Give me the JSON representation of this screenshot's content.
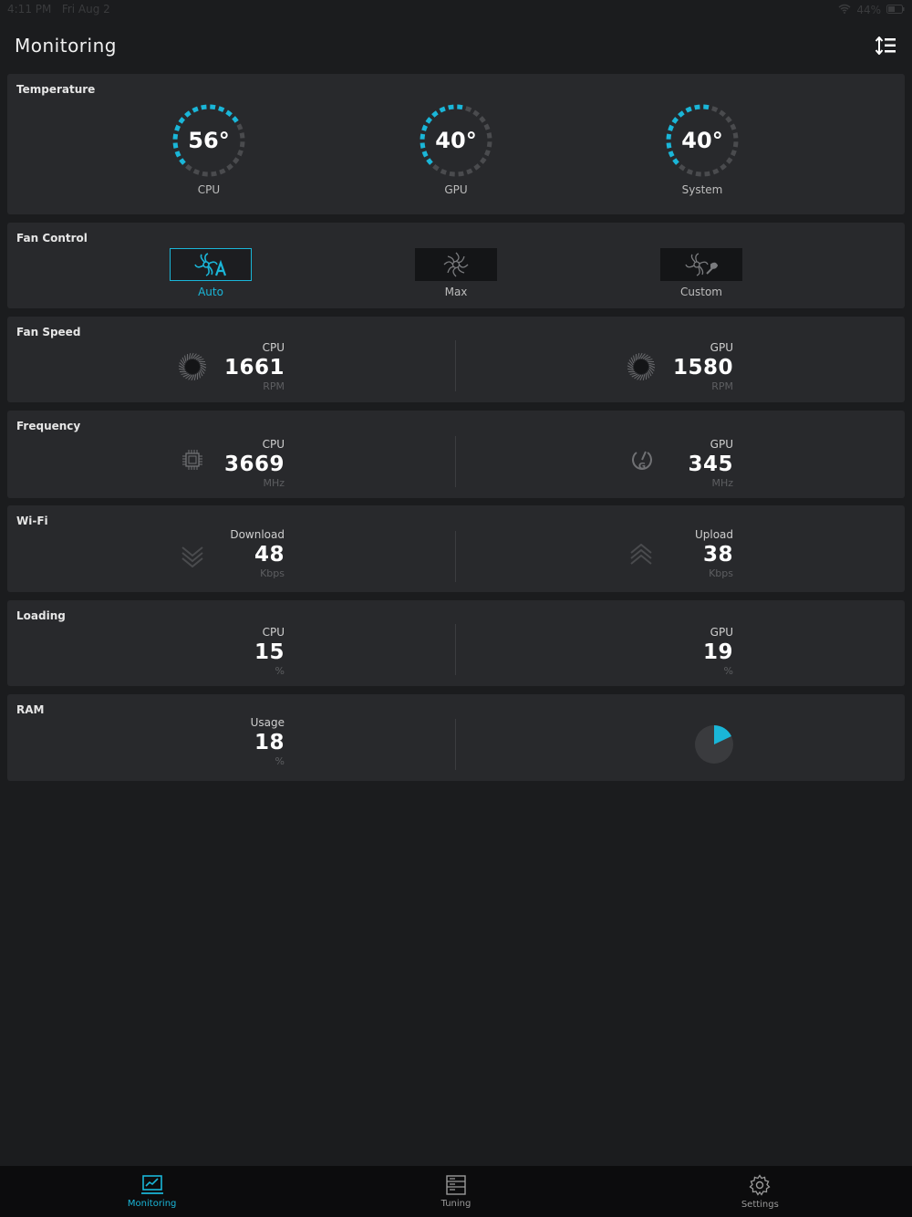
{
  "status_bar": {
    "time": "4:11 PM",
    "date": "Fri Aug 2",
    "battery": "44%"
  },
  "header": {
    "title": "Monitoring"
  },
  "colors": {
    "accent": "#1ab6d8",
    "background": "#1b1c1e",
    "card": "#28292c"
  },
  "temperature": {
    "title": "Temperature",
    "gauges": [
      {
        "label": "CPU",
        "value": "56°",
        "level": 0.56
      },
      {
        "label": "GPU",
        "value": "40°",
        "level": 0.4
      },
      {
        "label": "System",
        "value": "40°",
        "level": 0.4
      }
    ]
  },
  "fan_control": {
    "title": "Fan Control",
    "modes": [
      {
        "label": "Auto",
        "icon": "fan-auto-icon",
        "active": true
      },
      {
        "label": "Max",
        "icon": "fan-max-icon",
        "active": false
      },
      {
        "label": "Custom",
        "icon": "fan-custom-icon",
        "active": false
      }
    ]
  },
  "fan_speed": {
    "title": "Fan Speed",
    "cpu": {
      "caption": "CPU",
      "value": "1661",
      "unit": "RPM",
      "icon": "fan-icon"
    },
    "gpu": {
      "caption": "GPU",
      "value": "1580",
      "unit": "RPM",
      "icon": "fan-icon"
    }
  },
  "frequency": {
    "title": "Frequency",
    "cpu": {
      "caption": "CPU",
      "value": "3669",
      "unit": "MHz",
      "icon": "cpu-chip-icon"
    },
    "gpu": {
      "caption": "GPU",
      "value": "345",
      "unit": "MHz",
      "icon": "gpu-gauge-icon"
    }
  },
  "wifi": {
    "title": "Wi-Fi",
    "download": {
      "caption": "Download",
      "value": "48",
      "unit": "Kbps",
      "icon": "download-chevron-icon"
    },
    "upload": {
      "caption": "Upload",
      "value": "38",
      "unit": "Kbps",
      "icon": "upload-chevron-icon"
    }
  },
  "loading": {
    "title": "Loading",
    "cpu": {
      "caption": "CPU",
      "value": "15",
      "unit": "%"
    },
    "gpu": {
      "caption": "GPU",
      "value": "19",
      "unit": "%"
    }
  },
  "ram": {
    "title": "RAM",
    "usage": {
      "caption": "Usage",
      "value": "18",
      "unit": "%",
      "fraction": 0.18
    }
  },
  "tabs": [
    {
      "label": "Monitoring",
      "icon": "monitoring-icon",
      "active": true
    },
    {
      "label": "Tuning",
      "icon": "tuning-icon",
      "active": false
    },
    {
      "label": "Settings",
      "icon": "settings-gear-icon",
      "active": false
    }
  ]
}
